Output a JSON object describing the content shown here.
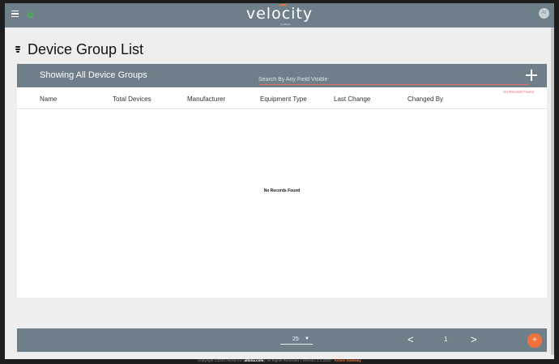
{
  "topbar": {
    "brand": "velocity",
    "brand_sub": "by atlona",
    "avatar_initials": "AI",
    "menu_icon": "hamburger-icon",
    "status_color": "#4caf50"
  },
  "page": {
    "title": "Device Group List",
    "icon": "device-group-icon"
  },
  "table": {
    "showing_label": "Showing All Device Groups",
    "search_placeholder": "Search By Any Field Visible",
    "search_hint": "No Records Found",
    "columns": [
      "Name",
      "Total Devices",
      "Manufacturer",
      "Equipment Type",
      "Last Change",
      "Changed By"
    ],
    "empty_message": "No Records Found"
  },
  "pagination": {
    "page_size": "25",
    "current_page": "1",
    "prev_symbol": "<",
    "next_symbol": ">",
    "fab_symbol": "+"
  },
  "footer": {
    "copyright_prefix": "Copyright ©2020 Atlona Inc (",
    "company_link": "atlona.com",
    "copyright_suffix": "). All Rights Reserved. | Version: 2.1.2022",
    "gateway_status": "Active Gateway"
  },
  "colors": {
    "header_bg": "#6e7f8a",
    "accent": "#f0713a",
    "error": "#e86b6b",
    "page_bg": "#eeeeee"
  }
}
